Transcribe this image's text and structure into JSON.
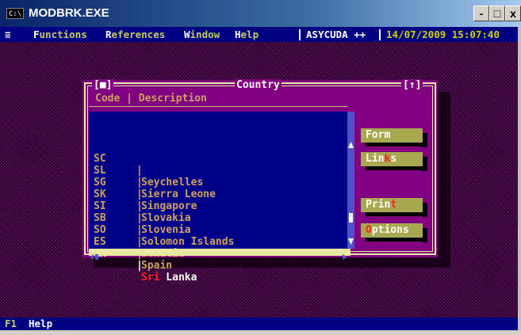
{
  "window": {
    "title": "MODBRK.EXE",
    "icon": "command-prompt-icon"
  },
  "window_controls": {
    "minimize": "-",
    "maximize": "□",
    "close": "x"
  },
  "menubar": {
    "system_glyph": "≡",
    "items": [
      {
        "label": "Functions",
        "accel": "F",
        "rest": "unctions"
      },
      {
        "label": "References",
        "accel": "R",
        "rest": "eferences"
      },
      {
        "label": "Window",
        "accel": "W",
        "rest": "indow"
      },
      {
        "label": "Help",
        "accel": "H",
        "rest": "elp"
      }
    ],
    "app_name": "ASYCUDA ++",
    "datetime": "14/07/2009 15:07:40"
  },
  "dialog": {
    "title": "Country",
    "left_marker": "[■]",
    "right_marker": "[↑]",
    "column_header": "Code | Description",
    "rows": [
      {
        "code": "SC",
        "desc": "Seychelles",
        "selected": false
      },
      {
        "code": "SL",
        "desc": "Sierra Leone",
        "selected": false
      },
      {
        "code": "SG",
        "desc": "Singapore",
        "selected": false
      },
      {
        "code": "SK",
        "desc": "Slovakia",
        "selected": false
      },
      {
        "code": "SI",
        "desc": "Slovenia",
        "selected": false
      },
      {
        "code": "SB",
        "desc": "Solomon Islands",
        "selected": false
      },
      {
        "code": "SO",
        "desc": "Somalia",
        "selected": false
      },
      {
        "code": "ES",
        "desc": "Spain",
        "selected": false
      },
      {
        "code": "LK",
        "desc_highlight": "Sri",
        "desc_rest": " Lanka",
        "selected": true
      }
    ],
    "buttons": {
      "form": {
        "pre": "Form",
        "acc": "",
        "post": ""
      },
      "links": {
        "pre": "Lin",
        "acc": "k",
        "post": "s"
      },
      "print": {
        "pre": "Prin",
        "acc": "t",
        "post": ""
      },
      "options": {
        "pre": "",
        "acc": "O",
        "post": "ptions"
      }
    }
  },
  "statusbar": {
    "key": "F1",
    "label": "Help"
  }
}
